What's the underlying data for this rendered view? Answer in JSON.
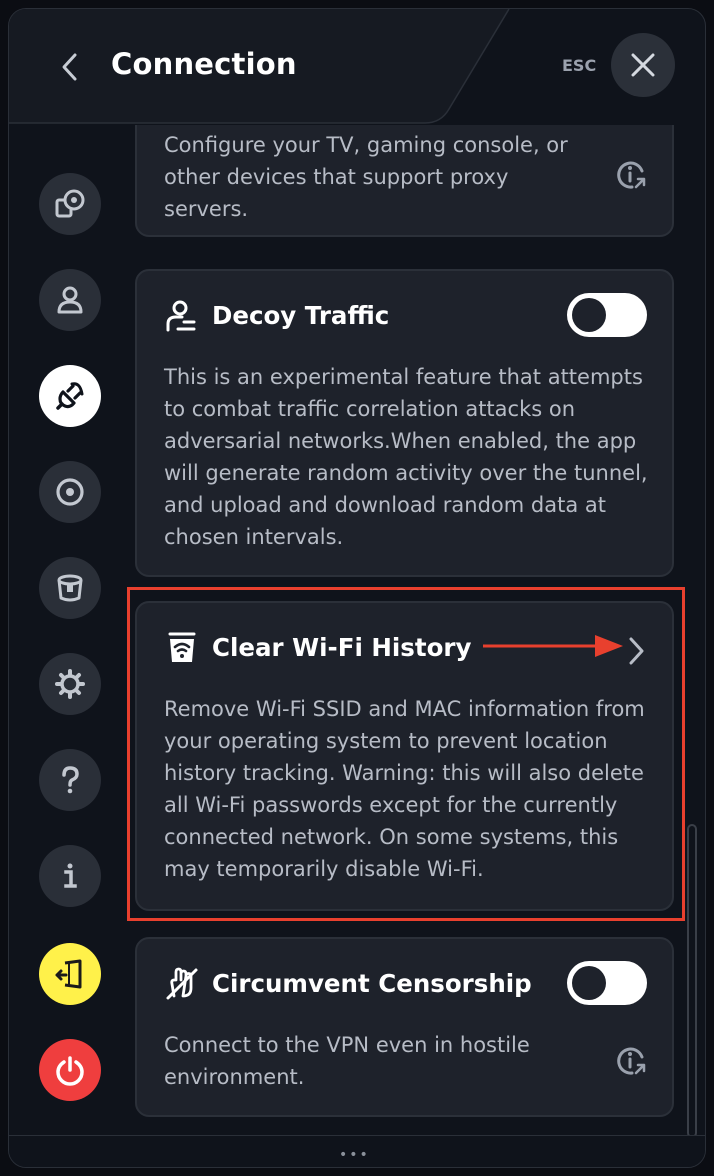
{
  "header": {
    "title": "Connection",
    "esc_label": "ESC"
  },
  "sidebar": {
    "items": [
      {
        "icon": "devices-icon"
      },
      {
        "icon": "account-icon"
      },
      {
        "icon": "connection-plug-icon",
        "active": true
      },
      {
        "icon": "target-icon"
      },
      {
        "icon": "bucket-icon"
      },
      {
        "icon": "gear-icon"
      },
      {
        "icon": "help-icon"
      },
      {
        "icon": "info-icon"
      },
      {
        "icon": "exit-door-icon"
      },
      {
        "icon": "power-icon"
      }
    ]
  },
  "cards": {
    "proxy": {
      "description": "Configure your TV, gaming console, or other devices that support proxy servers."
    },
    "decoy": {
      "title": "Decoy Traffic",
      "description": "This is an experimental feature that attempts to combat traffic correlation attacks on adversarial networks.When enabled, the app will generate random activity over the tunnel, and upload and download random data at chosen intervals.",
      "toggle_on": false
    },
    "wifi": {
      "title": "Clear Wi-Fi History",
      "description": "Remove Wi-Fi SSID and MAC information from your operating system to prevent location history tracking. Warning: this will also delete all Wi-Fi passwords except for the currently connected network. On some systems, this may temporarily disable Wi-Fi."
    },
    "censorship": {
      "title": "Circumvent Censorship",
      "description": "Connect to the VPN even in hostile environment.",
      "toggle_on": false
    }
  },
  "colors": {
    "highlight": "#e8402e",
    "accent_yellow": "#fff14a",
    "accent_red": "#ef3e3e"
  },
  "footer": {
    "dots": "•••"
  }
}
